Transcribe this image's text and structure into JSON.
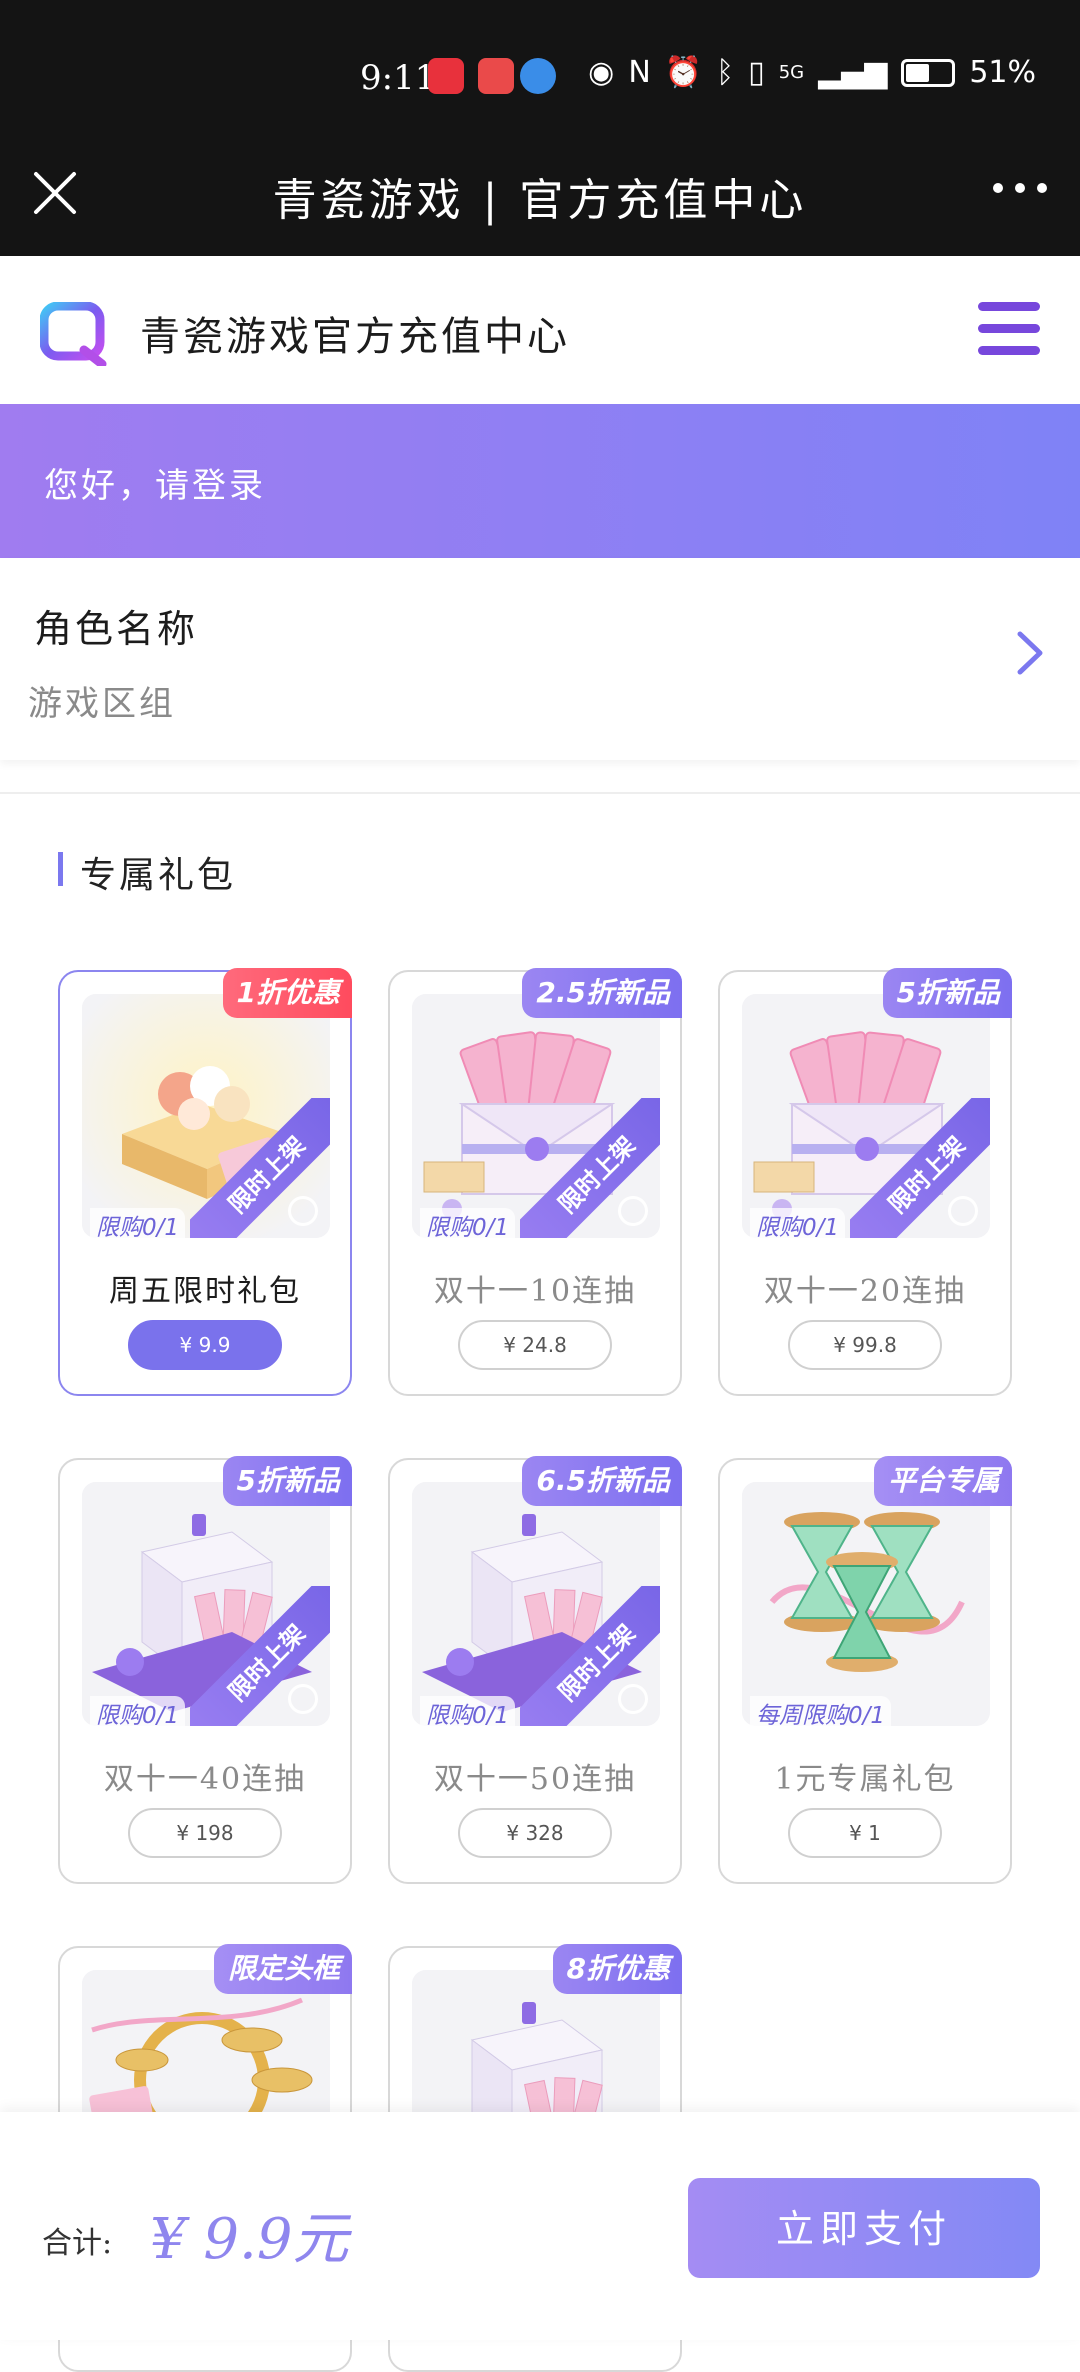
{
  "status_bar": {
    "time": "9:11",
    "battery": "51%",
    "battery_level": 0.51,
    "signal": "5G"
  },
  "titlebar": {
    "title": "青瓷游戏 | 官方充值中心"
  },
  "header": {
    "brand": "青瓷游戏官方充值中心"
  },
  "banner": {
    "greeting": "您好，请登录"
  },
  "role": {
    "name_label": "角色名称",
    "zone_label": "游戏区组"
  },
  "section": {
    "title": "专属礼包"
  },
  "packs": [
    {
      "badge": "1折优惠",
      "badge_color": "#ff4b5e",
      "limit": "限购0/1",
      "name": "周五限时礼包",
      "price": "¥ 9.9",
      "ribbon": "限时上架",
      "selected": true,
      "art": "flower-gift-box"
    },
    {
      "badge": "2.5折新品",
      "badge_color": "#7d6ff0",
      "limit": "限购0/1",
      "name": "双十一10连抽",
      "price": "¥ 24.8",
      "ribbon": "限时上架",
      "selected": false,
      "art": "ticket-envelope"
    },
    {
      "badge": "5折新品",
      "badge_color": "#7d6ff0",
      "limit": "限购0/1",
      "name": "双十一20连抽",
      "price": "¥ 99.8",
      "ribbon": "限时上架",
      "selected": false,
      "art": "ticket-envelope"
    },
    {
      "badge": "5折新品",
      "badge_color": "#7d6ff0",
      "limit": "限购0/1",
      "name": "双十一40连抽",
      "price": "¥ 198",
      "ribbon": "限时上架",
      "selected": false,
      "art": "ticket-cube"
    },
    {
      "badge": "6.5折新品",
      "badge_color": "#7d6ff0",
      "limit": "限购0/1",
      "name": "双十一50连抽",
      "price": "¥ 328",
      "ribbon": "限时上架",
      "selected": false,
      "art": "ticket-cube"
    },
    {
      "badge": "平台专属",
      "badge_color": "#8e78f0",
      "limit": "每周限购0/1",
      "name": "1元专属礼包",
      "price": "¥ 1",
      "ribbon": "",
      "selected": false,
      "art": "hourglass"
    },
    {
      "badge": "限定头框",
      "badge_color": "#8e78f0",
      "limit": "",
      "name": "",
      "price": "",
      "ribbon": "",
      "selected": false,
      "art": "coin-frame"
    },
    {
      "badge": "8折优惠",
      "badge_color": "#7d6ff0",
      "limit": "",
      "name": "",
      "price": "",
      "ribbon": "",
      "selected": false,
      "art": "ticket-cube"
    }
  ],
  "footer": {
    "total_label": "合计:",
    "total_value": "¥ 9.9元",
    "pay_label": "立即支付"
  }
}
